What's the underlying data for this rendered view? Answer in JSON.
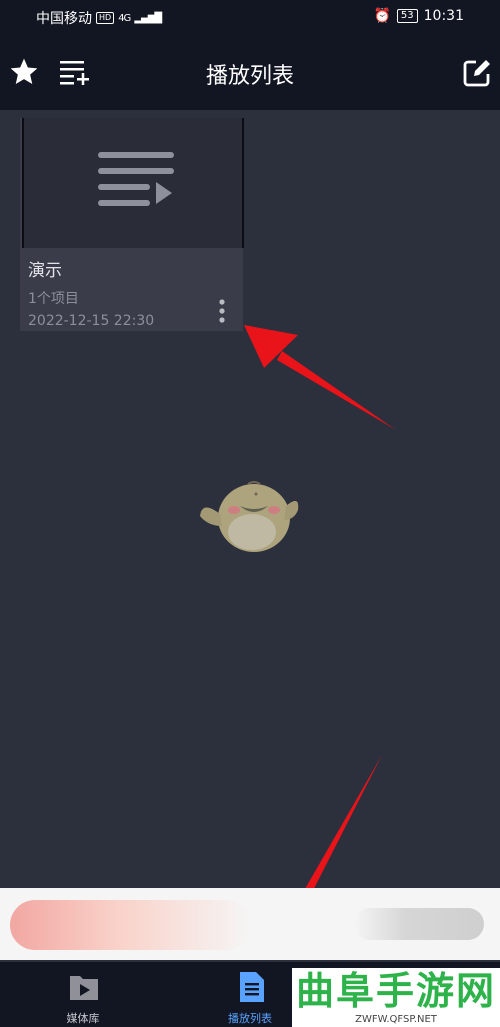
{
  "status_bar": {
    "carrier": "中国移动",
    "hd": "HD",
    "network": "4G",
    "battery": "53",
    "time": "10:31"
  },
  "app_bar": {
    "title": "播放列表"
  },
  "playlist_card": {
    "name": "演示",
    "item_count": "1个项目",
    "date": "2022-12-15 22:30"
  },
  "bottom_nav": {
    "items": [
      {
        "label": "媒体库",
        "icon": "folder-play-icon",
        "active": false
      },
      {
        "label": "播放列表",
        "icon": "list-icon",
        "active": true
      }
    ]
  },
  "watermark": {
    "title": "曲阜手游网",
    "url": "ZWFW.QFSP.NET"
  },
  "colors": {
    "background": "#2c2f3c",
    "bar": "#121522",
    "accent": "#5aa2ff",
    "annotation_arrow": "#e8141a"
  }
}
